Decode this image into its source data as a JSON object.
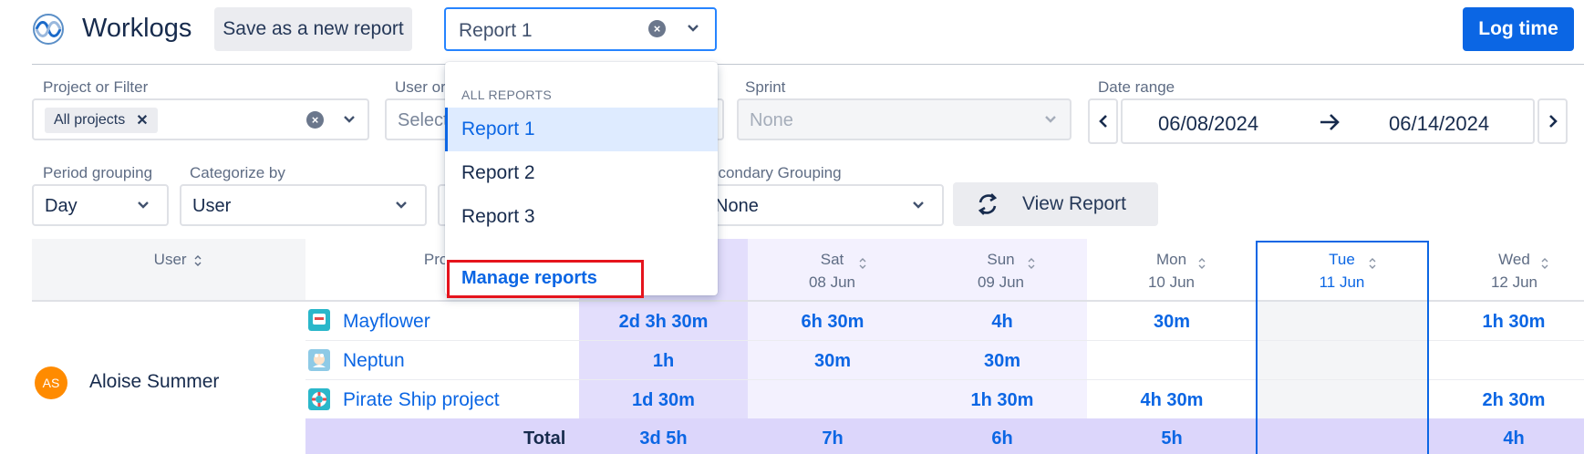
{
  "header": {
    "app_title": "Worklogs",
    "save_button": "Save as a new report",
    "report_select_value": "Report 1",
    "log_time_button": "Log time"
  },
  "filters": {
    "project_label": "Project or Filter",
    "project_tag": "All projects",
    "user_label": "User or",
    "user_placeholder": "Select",
    "sprint_label": "Sprint",
    "sprint_value": "None",
    "date_range_label": "Date range",
    "date_from": "06/08/2024",
    "date_to": "06/14/2024",
    "period_label": "Period grouping",
    "period_value": "Day",
    "categorize_label": "Categorize by",
    "categorize_value": "User",
    "secondary_label": "econdary Grouping",
    "secondary_value": "None",
    "view_report_button": "View Report"
  },
  "dropdown": {
    "header": "ALL REPORTS",
    "items": [
      "Report 1",
      "Report 2",
      "Report 3"
    ],
    "selected": "Report 1",
    "manage": "Manage reports"
  },
  "table": {
    "user_header": "User",
    "project_header": "Proj",
    "days": [
      {
        "dow": "Sat",
        "date": "08 Jun"
      },
      {
        "dow": "Sun",
        "date": "09 Jun"
      },
      {
        "dow": "Mon",
        "date": "10 Jun"
      },
      {
        "dow": "Tue",
        "date": "11 Jun"
      },
      {
        "dow": "Wed",
        "date": "12 Jun"
      }
    ],
    "user": {
      "initials": "AS",
      "name": "Aloise Summer"
    },
    "rows": [
      {
        "project": "Mayflower",
        "total": "2d 3h 30m",
        "sat": "6h 30m",
        "sun": "4h",
        "mon": "30m",
        "tue": "",
        "wed": "1h 30m"
      },
      {
        "project": "Neptun",
        "total": "1h",
        "sat": "30m",
        "sun": "30m",
        "mon": "",
        "tue": "",
        "wed": ""
      },
      {
        "project": "Pirate Ship project",
        "total": "1d 30m",
        "sat": "",
        "sun": "1h 30m",
        "mon": "4h 30m",
        "tue": "",
        "wed": "2h 30m"
      }
    ],
    "totals": {
      "label": "Total",
      "total": "3d 5h",
      "sat": "7h",
      "sun": "6h",
      "mon": "5h",
      "tue": "",
      "wed": "4h"
    }
  },
  "colors": {
    "accent": "#0b66e4",
    "highlight": "#e5141d",
    "weekend_bg": "#f3f1fe",
    "total_bg": "#dcd6fb"
  }
}
